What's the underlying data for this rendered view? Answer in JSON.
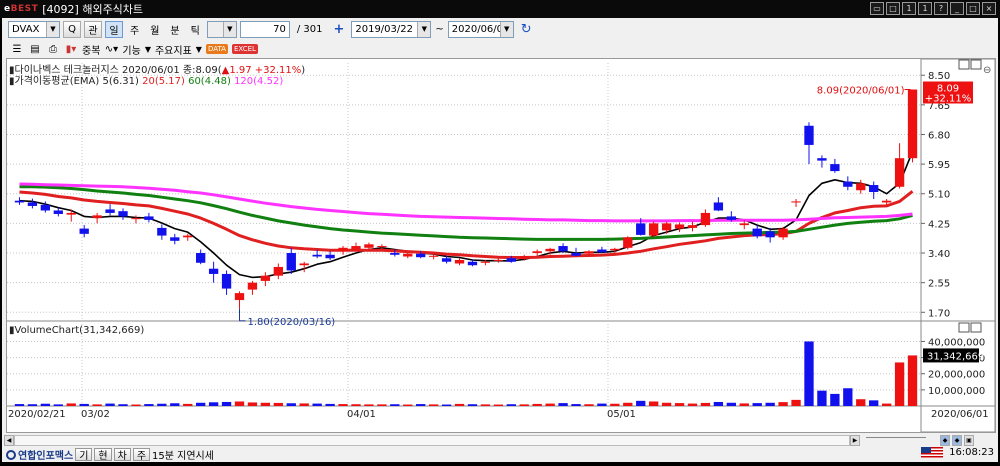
{
  "window": {
    "brand_prefix": "e",
    "brand_name": "BEST",
    "title": "[4092] 해외주식차트",
    "buttons": [
      "▭",
      "□",
      "1",
      "1",
      "?",
      "_",
      "□",
      "×"
    ]
  },
  "toolbar": {
    "symbol": "DVAX",
    "search_label": "Q",
    "tabs": [
      "관",
      "일",
      "주",
      "월",
      "분",
      "틱"
    ],
    "active_tab_index": 1,
    "count_value": "70",
    "total_label": "/ 301",
    "plus_label": "+",
    "date_from": "2019/03/22",
    "date_sep": "~",
    "date_to": "2020/06/01",
    "refresh_icon": "refresh-icon"
  },
  "toolbar2": {
    "overlap_label": "중복",
    "function_label": "기능",
    "indicator_label": "주요지표",
    "data_badge": "DATA",
    "excel_badge": "EXCEL"
  },
  "chart_data": [
    {
      "type": "candlestick",
      "title": "다이나벡스 테크놀러지스",
      "quote": {
        "date": "2020/06/01",
        "close_label": "종:8.09(",
        "change": "▲1.97",
        "change_pct": "+32.11%",
        "close_text_end": ")"
      },
      "ema_title": "가격이동평균(EMA) 5(6.31)",
      "ema_series": [
        {
          "name": "5(6.31)",
          "color": "#000000"
        },
        {
          "name": "20(5.17)",
          "color": "#e02020"
        },
        {
          "name": "60(4.48)",
          "color": "#108010"
        },
        {
          "name": "120(4.52)",
          "color": "#ff33ff"
        }
      ],
      "y_ticks": [
        8.5,
        7.65,
        6.8,
        5.95,
        5.1,
        4.25,
        3.4,
        2.55,
        1.7
      ],
      "y_tick_labels": [
        "8.50",
        "7.65",
        "6.80",
        "5.95",
        "5.10",
        "4.25",
        "3.40",
        "2.55",
        "1.70"
      ],
      "ylim": [
        1.45,
        8.85
      ],
      "last_price_label": "8.09",
      "last_change_label": "+32.11%",
      "max_annotation": "8.09(2020/06/01)",
      "min_annotation": "1.80(2020/03/16)",
      "candles": [
        [
          4.9,
          5.0,
          4.78,
          4.85
        ],
        [
          4.85,
          4.96,
          4.68,
          4.75
        ],
        [
          4.78,
          4.88,
          4.56,
          4.62
        ],
        [
          4.62,
          4.7,
          4.45,
          4.52
        ],
        [
          4.5,
          4.65,
          4.3,
          4.55
        ],
        [
          4.1,
          4.2,
          3.85,
          3.95
        ],
        [
          4.4,
          4.55,
          4.25,
          4.48
        ],
        [
          4.65,
          4.8,
          4.48,
          4.55
        ],
        [
          4.6,
          4.68,
          4.35,
          4.45
        ],
        [
          4.38,
          4.48,
          4.25,
          4.4
        ],
        [
          4.45,
          4.55,
          4.28,
          4.35
        ],
        [
          4.12,
          4.22,
          3.78,
          3.9
        ],
        [
          3.85,
          3.95,
          3.65,
          3.75
        ],
        [
          3.85,
          3.95,
          3.75,
          3.9
        ],
        [
          3.4,
          3.5,
          3.08,
          3.12
        ],
        [
          2.95,
          3.15,
          2.55,
          2.8
        ],
        [
          2.8,
          2.9,
          2.2,
          2.38
        ],
        [
          2.05,
          2.3,
          1.8,
          2.25
        ],
        [
          2.35,
          2.6,
          2.2,
          2.55
        ],
        [
          2.6,
          2.85,
          2.45,
          2.75
        ],
        [
          2.75,
          3.1,
          2.65,
          3.0
        ],
        [
          3.4,
          3.55,
          2.8,
          2.9
        ],
        [
          3.05,
          3.15,
          2.85,
          3.1
        ],
        [
          3.35,
          3.5,
          3.25,
          3.3
        ],
        [
          3.35,
          3.45,
          3.2,
          3.25
        ],
        [
          3.45,
          3.6,
          3.35,
          3.55
        ],
        [
          3.5,
          3.7,
          3.45,
          3.6
        ],
        [
          3.55,
          3.7,
          3.45,
          3.65
        ],
        [
          3.58,
          3.65,
          3.5,
          3.6
        ],
        [
          3.4,
          3.5,
          3.3,
          3.35
        ],
        [
          3.3,
          3.42,
          3.25,
          3.38
        ],
        [
          3.38,
          3.45,
          3.25,
          3.28
        ],
        [
          3.3,
          3.4,
          3.22,
          3.32
        ],
        [
          3.25,
          3.32,
          3.1,
          3.15
        ],
        [
          3.1,
          3.25,
          3.05,
          3.2
        ],
        [
          3.15,
          3.22,
          3.02,
          3.05
        ],
        [
          3.12,
          3.2,
          3.05,
          3.15
        ],
        [
          3.18,
          3.25,
          3.12,
          3.2
        ],
        [
          3.25,
          3.32,
          3.12,
          3.15
        ],
        [
          3.25,
          3.35,
          3.18,
          3.3
        ],
        [
          3.4,
          3.5,
          3.32,
          3.45
        ],
        [
          3.45,
          3.55,
          3.35,
          3.52
        ],
        [
          3.6,
          3.68,
          3.4,
          3.45
        ],
        [
          3.4,
          3.55,
          3.3,
          3.32
        ],
        [
          3.38,
          3.48,
          3.3,
          3.45
        ],
        [
          3.5,
          3.58,
          3.4,
          3.42
        ],
        [
          3.48,
          3.55,
          3.35,
          3.52
        ],
        [
          3.55,
          3.88,
          3.5,
          3.85
        ],
        [
          4.25,
          4.4,
          3.9,
          3.92
        ],
        [
          3.9,
          4.3,
          3.85,
          4.25
        ],
        [
          4.05,
          4.3,
          3.95,
          4.25
        ],
        [
          4.1,
          4.28,
          4.0,
          4.22
        ],
        [
          4.12,
          4.3,
          4.02,
          4.2
        ],
        [
          4.2,
          4.65,
          4.15,
          4.55
        ],
        [
          4.85,
          5.0,
          4.6,
          4.62
        ],
        [
          4.45,
          4.6,
          4.3,
          4.35
        ],
        [
          4.2,
          4.35,
          4.08,
          4.25
        ],
        [
          4.1,
          4.2,
          3.82,
          3.88
        ],
        [
          4.02,
          4.12,
          3.7,
          3.85
        ],
        [
          3.85,
          4.15,
          3.78,
          4.1
        ],
        [
          4.85,
          4.95,
          4.72,
          4.88
        ],
        [
          7.05,
          7.15,
          5.95,
          6.5
        ],
        [
          6.12,
          6.2,
          5.85,
          6.05
        ],
        [
          5.95,
          6.1,
          5.7,
          5.75
        ],
        [
          5.45,
          5.6,
          5.2,
          5.3
        ],
        [
          5.2,
          5.5,
          5.1,
          5.4
        ],
        [
          5.35,
          5.45,
          4.95,
          5.15
        ],
        [
          4.85,
          4.95,
          4.75,
          4.9
        ],
        [
          5.3,
          6.55,
          5.25,
          6.12
        ],
        [
          6.12,
          8.09,
          6.0,
          8.09
        ]
      ],
      "ema5": [
        4.9,
        4.88,
        4.8,
        4.7,
        4.62,
        4.45,
        4.42,
        4.45,
        4.45,
        4.42,
        4.4,
        4.26,
        4.1,
        4.0,
        3.72,
        3.4,
        3.05,
        2.78,
        2.7,
        2.72,
        2.8,
        2.85,
        2.95,
        3.08,
        3.15,
        3.28,
        3.4,
        3.5,
        3.55,
        3.5,
        3.45,
        3.4,
        3.37,
        3.3,
        3.27,
        3.2,
        3.18,
        3.18,
        3.17,
        3.22,
        3.3,
        3.4,
        3.45,
        3.4,
        3.42,
        3.42,
        3.45,
        3.58,
        3.7,
        3.9,
        4.0,
        4.1,
        4.15,
        4.28,
        4.4,
        4.4,
        4.35,
        4.2,
        4.08,
        4.1,
        4.35,
        5.05,
        5.4,
        5.5,
        5.42,
        5.4,
        5.3,
        5.1,
        5.4,
        6.31
      ],
      "ema20": [
        5.15,
        5.12,
        5.08,
        5.02,
        4.98,
        4.92,
        4.88,
        4.85,
        4.82,
        4.78,
        4.75,
        4.68,
        4.6,
        4.52,
        4.4,
        4.25,
        4.08,
        3.9,
        3.78,
        3.68,
        3.6,
        3.55,
        3.52,
        3.5,
        3.48,
        3.48,
        3.48,
        3.48,
        3.48,
        3.46,
        3.44,
        3.42,
        3.4,
        3.37,
        3.35,
        3.32,
        3.3,
        3.28,
        3.27,
        3.27,
        3.28,
        3.3,
        3.31,
        3.32,
        3.33,
        3.34,
        3.36,
        3.4,
        3.45,
        3.52,
        3.58,
        3.65,
        3.7,
        3.75,
        3.82,
        3.86,
        3.9,
        3.92,
        3.93,
        3.95,
        4.02,
        4.25,
        4.42,
        4.55,
        4.62,
        4.7,
        4.74,
        4.75,
        4.88,
        5.17
      ],
      "ema60": [
        5.3,
        5.3,
        5.29,
        5.27,
        5.25,
        5.22,
        5.18,
        5.15,
        5.12,
        5.08,
        5.05,
        5.0,
        4.95,
        4.9,
        4.84,
        4.76,
        4.67,
        4.57,
        4.48,
        4.4,
        4.32,
        4.26,
        4.2,
        4.15,
        4.1,
        4.06,
        4.03,
        4.0,
        3.97,
        3.95,
        3.93,
        3.91,
        3.89,
        3.87,
        3.85,
        3.84,
        3.83,
        3.82,
        3.81,
        3.8,
        3.79,
        3.79,
        3.79,
        3.79,
        3.79,
        3.79,
        3.8,
        3.81,
        3.82,
        3.84,
        3.86,
        3.88,
        3.9,
        3.92,
        3.94,
        3.96,
        3.97,
        3.98,
        3.99,
        4.0,
        4.02,
        4.08,
        4.14,
        4.2,
        4.25,
        4.28,
        4.31,
        4.33,
        4.38,
        4.48
      ],
      "ema120": [
        5.38,
        5.37,
        5.36,
        5.35,
        5.34,
        5.33,
        5.32,
        5.31,
        5.3,
        5.28,
        5.26,
        5.23,
        5.2,
        5.16,
        5.12,
        5.07,
        5.01,
        4.95,
        4.89,
        4.83,
        4.78,
        4.73,
        4.69,
        4.65,
        4.62,
        4.59,
        4.56,
        4.53,
        4.51,
        4.49,
        4.47,
        4.45,
        4.44,
        4.43,
        4.42,
        4.41,
        4.4,
        4.39,
        4.38,
        4.37,
        4.36,
        4.35,
        4.35,
        4.34,
        4.33,
        4.33,
        4.32,
        4.32,
        4.32,
        4.32,
        4.32,
        4.33,
        4.33,
        4.33,
        4.34,
        4.34,
        4.34,
        4.34,
        4.34,
        4.34,
        4.35,
        4.37,
        4.39,
        4.41,
        4.42,
        4.43,
        4.44,
        4.45,
        4.48,
        4.52
      ]
    },
    {
      "type": "bar",
      "title": "VolumeChart(31,342,669)",
      "y_ticks": [
        10000000,
        20000000,
        30000000,
        40000000
      ],
      "y_tick_labels": [
        "10,000,000",
        "20,000,000",
        "30,000,000",
        "40,000,000"
      ],
      "ylim": [
        0,
        44000000
      ],
      "last_value_label": "31,342,669",
      "values": [
        1.2,
        1.1,
        1.4,
        1.0,
        1.6,
        1.3,
        1.0,
        1.5,
        1.1,
        0.9,
        1.2,
        1.4,
        1.7,
        1.3,
        2.0,
        2.3,
        2.5,
        2.8,
        2.2,
        2.0,
        1.9,
        1.7,
        1.6,
        1.5,
        1.3,
        1.2,
        1.1,
        1.0,
        1.0,
        1.1,
        0.9,
        1.2,
        1.0,
        0.9,
        1.3,
        1.1,
        1.0,
        0.9,
        1.1,
        1.0,
        1.3,
        1.5,
        1.8,
        1.2,
        1.1,
        1.5,
        1.4,
        2.0,
        3.2,
        2.8,
        2.0,
        1.8,
        1.5,
        1.9,
        2.5,
        2.0,
        1.6,
        1.8,
        2.0,
        2.4,
        3.8,
        40.0,
        9.5,
        7.5,
        11.0,
        4.2,
        3.5,
        1.5,
        27.0,
        31.342669
      ]
    }
  ],
  "x_axis": {
    "labels": [
      "2020/02/21",
      "03/02",
      "04/01",
      "05/01",
      "2020/06/01"
    ]
  },
  "bottom": {
    "company": "연합인포맥스",
    "buttons": [
      "기",
      "현",
      "차",
      "주"
    ],
    "delay_text": "15분 지연시세",
    "time": "16:08:23"
  }
}
